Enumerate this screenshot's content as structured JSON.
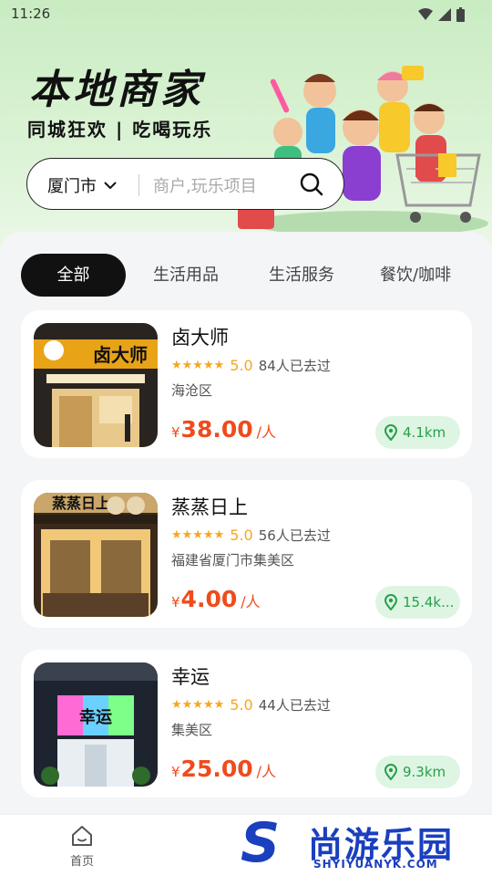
{
  "status": {
    "time": "11:26"
  },
  "header": {
    "title": "本地商家",
    "subtitle": "同城狂欢 | 吃喝玩乐"
  },
  "search": {
    "city": "厦门市",
    "placeholder": "商户,玩乐项目"
  },
  "tabs": [
    {
      "label": "全部",
      "active": true
    },
    {
      "label": "生活用品",
      "active": false
    },
    {
      "label": "生活服务",
      "active": false
    },
    {
      "label": "餐饮/咖啡",
      "active": false
    }
  ],
  "merchants": [
    {
      "name": "卤大师",
      "stars": "★★★★★",
      "score": "5.0",
      "visits": "84人已去过",
      "area": "海沧区",
      "currency": "¥",
      "price": "38.00",
      "unit": "/人",
      "distance": "4.1km",
      "sign": "卤大师"
    },
    {
      "name": "蒸蒸日上",
      "stars": "★★★★★",
      "score": "5.0",
      "visits": "56人已去过",
      "area": "福建省厦门市集美区",
      "currency": "¥",
      "price": "4.00",
      "unit": "/人",
      "distance": "15.4k...",
      "sign": "蒸蒸日上"
    },
    {
      "name": "幸运",
      "stars": "★★★★★",
      "score": "5.0",
      "visits": "44人已去过",
      "area": "集美区",
      "currency": "¥",
      "price": "25.00",
      "unit": "/人",
      "distance": "9.3km",
      "sign": "幸运"
    }
  ],
  "nav": {
    "home_label": "首页"
  },
  "watermark": {
    "logo": "S",
    "cn": "尚游乐园",
    "en": "SHYIYUANYK.COM"
  },
  "colors": {
    "accent": "#f04b1c",
    "green": "#26a04a",
    "star": "#f5a623",
    "hero": "#c9ecc2"
  }
}
